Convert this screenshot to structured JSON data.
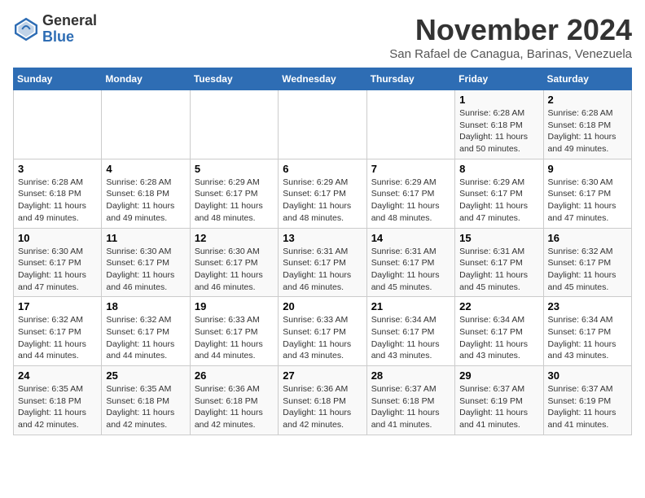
{
  "header": {
    "logo_line1": "General",
    "logo_line2": "Blue",
    "month": "November 2024",
    "location": "San Rafael de Canagua, Barinas, Venezuela"
  },
  "weekdays": [
    "Sunday",
    "Monday",
    "Tuesday",
    "Wednesday",
    "Thursday",
    "Friday",
    "Saturday"
  ],
  "weeks": [
    [
      {
        "day": "",
        "info": ""
      },
      {
        "day": "",
        "info": ""
      },
      {
        "day": "",
        "info": ""
      },
      {
        "day": "",
        "info": ""
      },
      {
        "day": "",
        "info": ""
      },
      {
        "day": "1",
        "info": "Sunrise: 6:28 AM\nSunset: 6:18 PM\nDaylight: 11 hours\nand 50 minutes."
      },
      {
        "day": "2",
        "info": "Sunrise: 6:28 AM\nSunset: 6:18 PM\nDaylight: 11 hours\nand 49 minutes."
      }
    ],
    [
      {
        "day": "3",
        "info": "Sunrise: 6:28 AM\nSunset: 6:18 PM\nDaylight: 11 hours\nand 49 minutes."
      },
      {
        "day": "4",
        "info": "Sunrise: 6:28 AM\nSunset: 6:18 PM\nDaylight: 11 hours\nand 49 minutes."
      },
      {
        "day": "5",
        "info": "Sunrise: 6:29 AM\nSunset: 6:17 PM\nDaylight: 11 hours\nand 48 minutes."
      },
      {
        "day": "6",
        "info": "Sunrise: 6:29 AM\nSunset: 6:17 PM\nDaylight: 11 hours\nand 48 minutes."
      },
      {
        "day": "7",
        "info": "Sunrise: 6:29 AM\nSunset: 6:17 PM\nDaylight: 11 hours\nand 48 minutes."
      },
      {
        "day": "8",
        "info": "Sunrise: 6:29 AM\nSunset: 6:17 PM\nDaylight: 11 hours\nand 47 minutes."
      },
      {
        "day": "9",
        "info": "Sunrise: 6:30 AM\nSunset: 6:17 PM\nDaylight: 11 hours\nand 47 minutes."
      }
    ],
    [
      {
        "day": "10",
        "info": "Sunrise: 6:30 AM\nSunset: 6:17 PM\nDaylight: 11 hours\nand 47 minutes."
      },
      {
        "day": "11",
        "info": "Sunrise: 6:30 AM\nSunset: 6:17 PM\nDaylight: 11 hours\nand 46 minutes."
      },
      {
        "day": "12",
        "info": "Sunrise: 6:30 AM\nSunset: 6:17 PM\nDaylight: 11 hours\nand 46 minutes."
      },
      {
        "day": "13",
        "info": "Sunrise: 6:31 AM\nSunset: 6:17 PM\nDaylight: 11 hours\nand 46 minutes."
      },
      {
        "day": "14",
        "info": "Sunrise: 6:31 AM\nSunset: 6:17 PM\nDaylight: 11 hours\nand 45 minutes."
      },
      {
        "day": "15",
        "info": "Sunrise: 6:31 AM\nSunset: 6:17 PM\nDaylight: 11 hours\nand 45 minutes."
      },
      {
        "day": "16",
        "info": "Sunrise: 6:32 AM\nSunset: 6:17 PM\nDaylight: 11 hours\nand 45 minutes."
      }
    ],
    [
      {
        "day": "17",
        "info": "Sunrise: 6:32 AM\nSunset: 6:17 PM\nDaylight: 11 hours\nand 44 minutes."
      },
      {
        "day": "18",
        "info": "Sunrise: 6:32 AM\nSunset: 6:17 PM\nDaylight: 11 hours\nand 44 minutes."
      },
      {
        "day": "19",
        "info": "Sunrise: 6:33 AM\nSunset: 6:17 PM\nDaylight: 11 hours\nand 44 minutes."
      },
      {
        "day": "20",
        "info": "Sunrise: 6:33 AM\nSunset: 6:17 PM\nDaylight: 11 hours\nand 43 minutes."
      },
      {
        "day": "21",
        "info": "Sunrise: 6:34 AM\nSunset: 6:17 PM\nDaylight: 11 hours\nand 43 minutes."
      },
      {
        "day": "22",
        "info": "Sunrise: 6:34 AM\nSunset: 6:17 PM\nDaylight: 11 hours\nand 43 minutes."
      },
      {
        "day": "23",
        "info": "Sunrise: 6:34 AM\nSunset: 6:17 PM\nDaylight: 11 hours\nand 43 minutes."
      }
    ],
    [
      {
        "day": "24",
        "info": "Sunrise: 6:35 AM\nSunset: 6:18 PM\nDaylight: 11 hours\nand 42 minutes."
      },
      {
        "day": "25",
        "info": "Sunrise: 6:35 AM\nSunset: 6:18 PM\nDaylight: 11 hours\nand 42 minutes."
      },
      {
        "day": "26",
        "info": "Sunrise: 6:36 AM\nSunset: 6:18 PM\nDaylight: 11 hours\nand 42 minutes."
      },
      {
        "day": "27",
        "info": "Sunrise: 6:36 AM\nSunset: 6:18 PM\nDaylight: 11 hours\nand 42 minutes."
      },
      {
        "day": "28",
        "info": "Sunrise: 6:37 AM\nSunset: 6:18 PM\nDaylight: 11 hours\nand 41 minutes."
      },
      {
        "day": "29",
        "info": "Sunrise: 6:37 AM\nSunset: 6:19 PM\nDaylight: 11 hours\nand 41 minutes."
      },
      {
        "day": "30",
        "info": "Sunrise: 6:37 AM\nSunset: 6:19 PM\nDaylight: 11 hours\nand 41 minutes."
      }
    ]
  ]
}
